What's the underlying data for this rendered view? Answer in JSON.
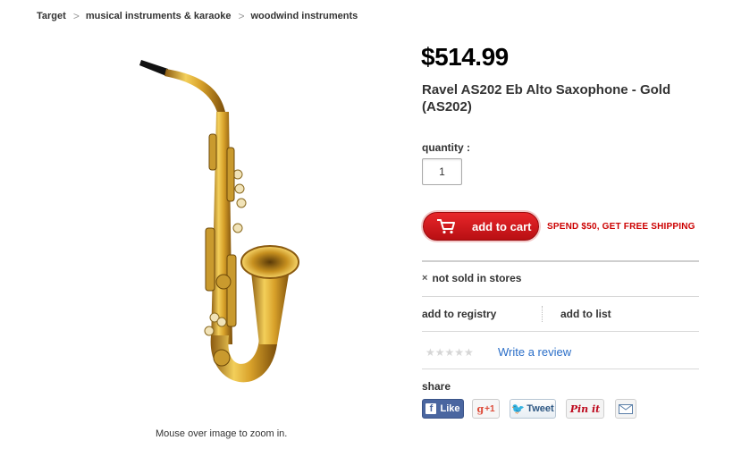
{
  "breadcrumb": {
    "items": [
      "Target",
      "musical instruments & karaoke",
      "woodwind instruments"
    ],
    "separator": ">"
  },
  "product": {
    "price": "$514.99",
    "title": "Ravel AS202 Eb Alto Saxophone - Gold (AS202)",
    "zoom_hint": "Mouse over image to zoom in.",
    "image_icon": "alto-saxophone-gold"
  },
  "purchase": {
    "quantity_label": "quantity :",
    "quantity_value": "1",
    "add_to_cart_label": "add to cart",
    "free_shipping": "SPEND $50, GET FREE SHIPPING"
  },
  "availability": {
    "x_mark": "×",
    "not_sold": "not sold in stores"
  },
  "actions": {
    "registry": "add to registry",
    "list": "add to list"
  },
  "reviews": {
    "stars": "★★★★★",
    "write_review": "Write a review",
    "rating": 0
  },
  "share": {
    "label": "share",
    "facebook_icon": "f",
    "facebook": "Like",
    "google": "+1",
    "google_icon": "g",
    "twitter": "Tweet",
    "twitter_icon": "🐦",
    "pinterest": "Pin it"
  },
  "colors": {
    "accent_red": "#cc0000",
    "link_blue": "#2a6ec8",
    "facebook_blue": "#4a66a0"
  }
}
